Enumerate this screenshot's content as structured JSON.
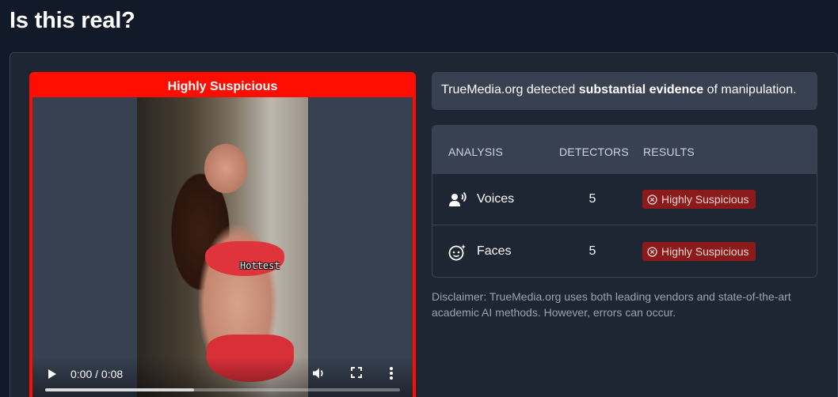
{
  "page": {
    "title": "Is this real?"
  },
  "video": {
    "verdict": "Highly Suspicious",
    "caption": "Hottest",
    "time": "0:00 / 0:08",
    "progress": 0.42,
    "frame_color": "#ff0d00"
  },
  "summary": {
    "prefix": "TrueMedia.org detected ",
    "emphasis": "substantial evidence",
    "suffix": " of manipulation."
  },
  "analysis": {
    "headers": {
      "analysis": "ANALYSIS",
      "detectors": "DETECTORS",
      "results": "RESULTS"
    },
    "rows": [
      {
        "icon": "voice-icon",
        "label": "Voices",
        "detectors": "5",
        "result": "Highly Suspicious"
      },
      {
        "icon": "face-icon",
        "label": "Faces",
        "detectors": "5",
        "result": "Highly Suspicious"
      }
    ],
    "badge_color": "#8b1a1a"
  },
  "disclaimer": "Disclaimer: TrueMedia.org uses both leading vendors and state-of-the-art academic AI methods. However, errors can occur."
}
